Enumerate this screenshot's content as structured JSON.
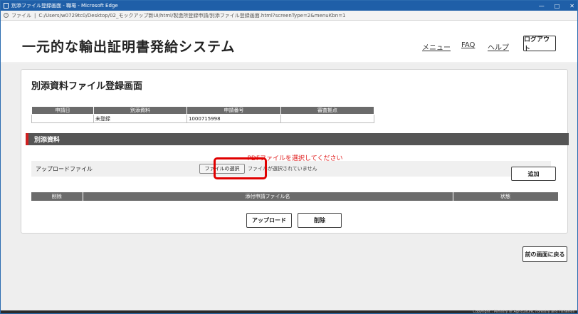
{
  "browser": {
    "window_title": "別添ファイル登録画面 - 職場 - Microsoft Edge",
    "min_icon": "minimize-icon",
    "max_icon": "maximize-icon",
    "close_label": "✕",
    "address_prefix": "ファイル",
    "address": "C:/Users/w0729tc0/Desktop/02_モックアップ新UI/html/製造所登録申請/別添ファイル登録画面.html?screenType=2&menuKbn=1"
  },
  "header": {
    "app_title": "一元的な輸出証明書発給システム",
    "nav": {
      "menu": "メニュー",
      "faq": "FAQ",
      "help": "ヘルプ"
    },
    "logout": "ログアウト"
  },
  "card": {
    "title": "別添資料ファイル登録画面",
    "info_table": {
      "headers": [
        "申請日",
        "別添資料",
        "申請番号",
        "審査拠点"
      ],
      "row": [
        "",
        "未登録",
        "1000715998",
        ""
      ]
    },
    "section_title": "別添資料",
    "pdf_message": "PDFファイルを選択してください",
    "upload": {
      "label": "アップロードファイル",
      "choose_button": "ファイルの選択",
      "status": "ファイルが選択されていません",
      "add_button": "追加"
    },
    "files_table": {
      "headers": [
        "削除",
        "添付申請ファイル名",
        "状態"
      ]
    },
    "upload_button": "アップロード",
    "delete_button": "削除"
  },
  "back_button": "前の画面に戻る",
  "footer": {
    "copyright": "Copyright : Ministry of Agriculture, Forestry and Fisheries"
  },
  "colors": {
    "accent_red": "#e00000",
    "section_bar": "#555555",
    "titlebar": "#1f5fa8"
  }
}
